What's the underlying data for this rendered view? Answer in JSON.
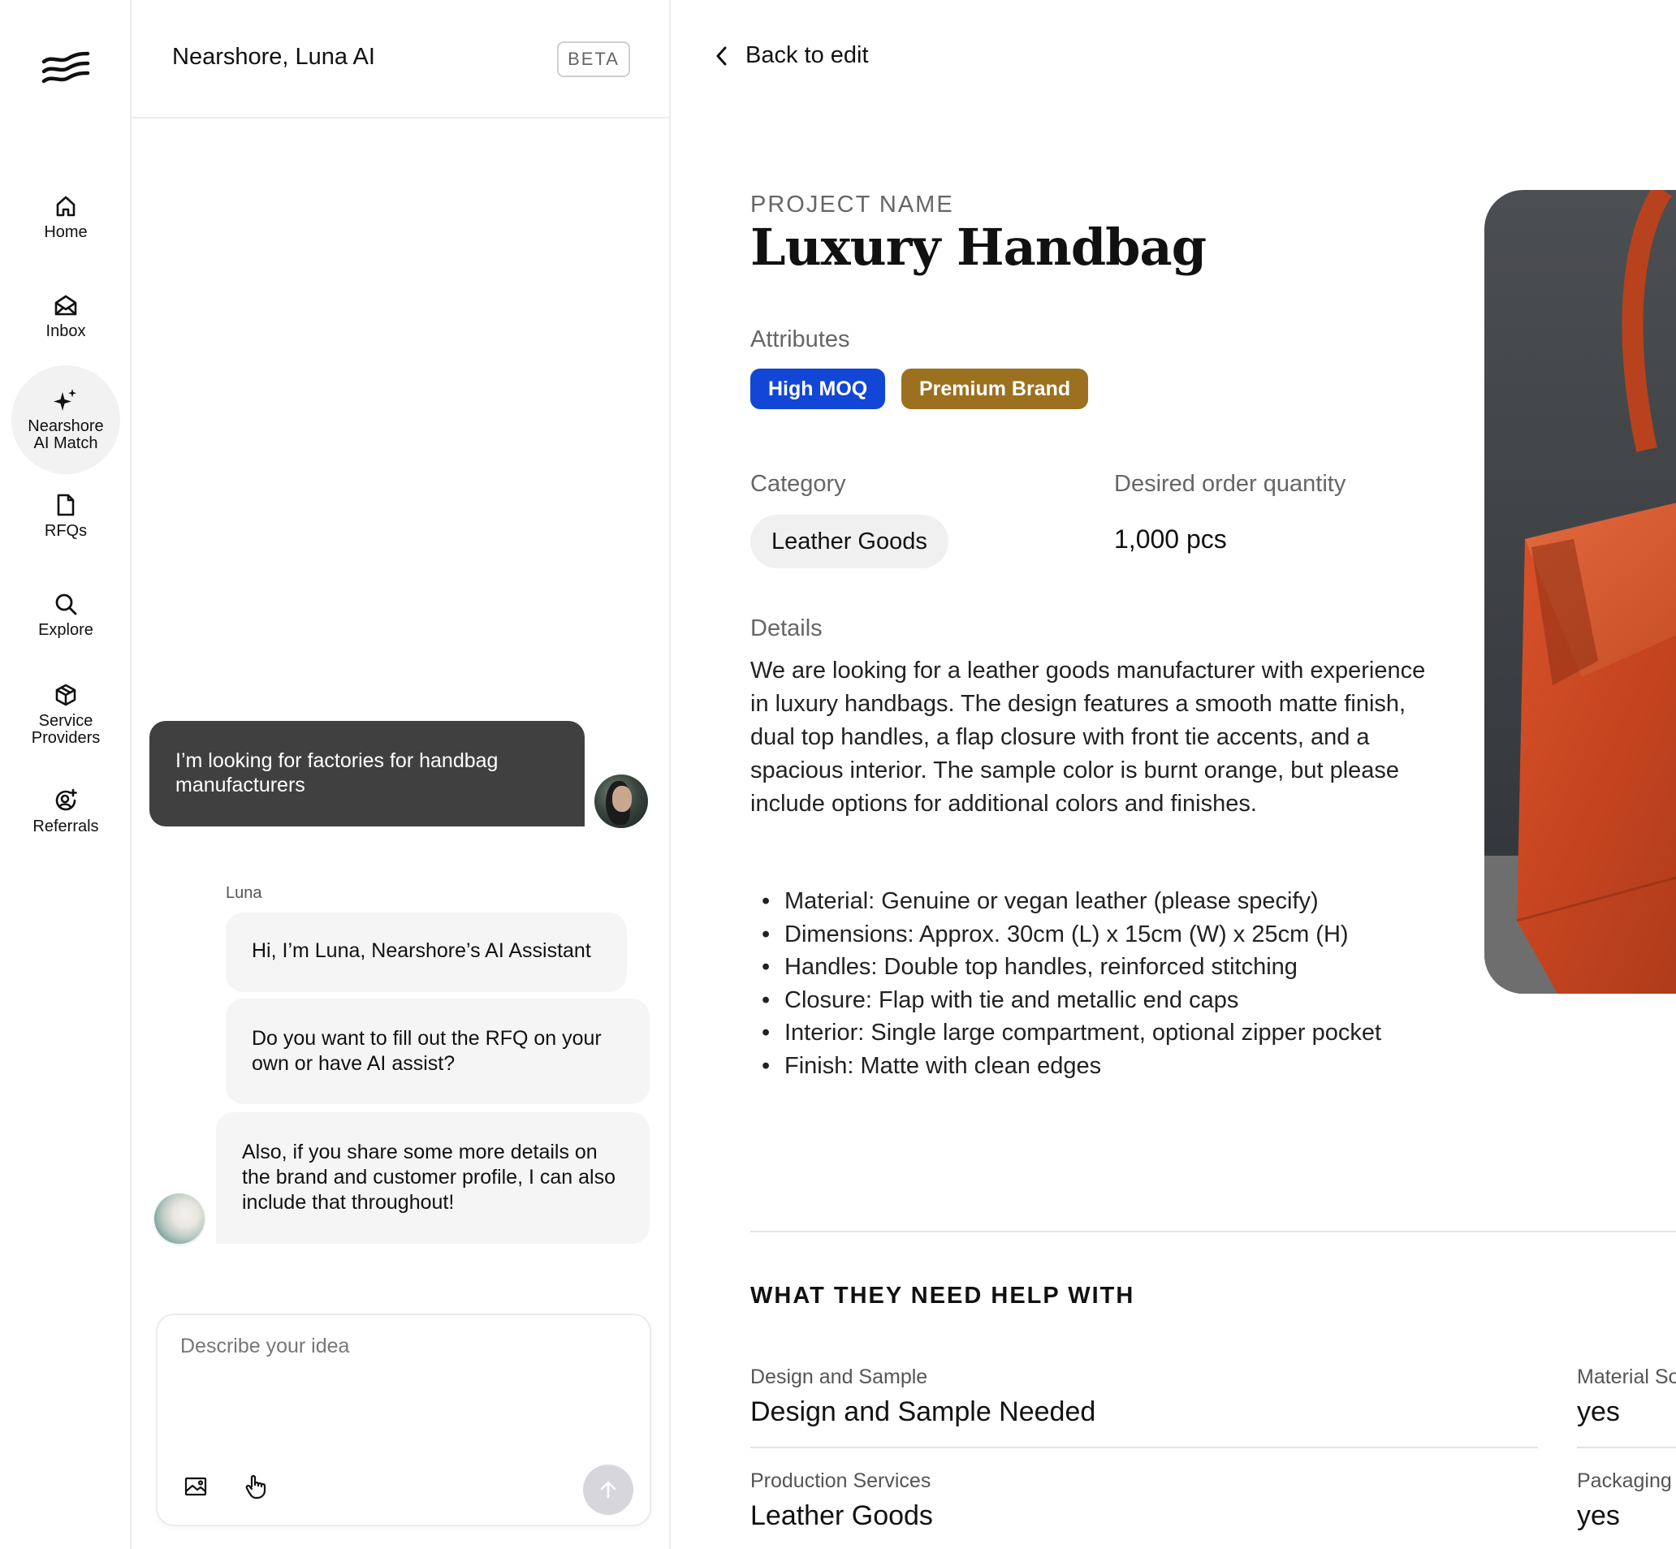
{
  "nav": {
    "items": [
      {
        "label": "Home",
        "icon": "home-icon"
      },
      {
        "label": "Inbox",
        "icon": "inbox-icon"
      },
      {
        "label": "Nearshore\nAI Match",
        "icon": "sparkle-icon",
        "active": true
      },
      {
        "label": "RFQs",
        "icon": "document-icon"
      },
      {
        "label": "Explore",
        "icon": "search-icon"
      },
      {
        "label": "Service\nProviders",
        "icon": "cube-icon"
      },
      {
        "label": "Referrals",
        "icon": "referral-icon"
      }
    ]
  },
  "chat": {
    "title": "Nearshore, Luna AI",
    "badge": "BETA",
    "user_message": "I’m looking for factories for handbag manufacturers",
    "assistant_name": "Luna",
    "assistant_messages": [
      "Hi, I’m Luna, Nearshore’s AI Assistant",
      "Do you want to fill out the RFQ on your own or have AI assist?",
      "Also, if you share some more details on the brand and customer profile, I can also include that throughout!"
    ],
    "composer": {
      "placeholder": "Describe your idea",
      "value": ""
    }
  },
  "main": {
    "back_label": "Back to edit",
    "project_label": "PROJECT NAME",
    "project_name": "Luxury Handbag",
    "attributes_label": "Attributes",
    "attributes": [
      {
        "label": "High MOQ",
        "color": "#1146d6"
      },
      {
        "label": "Premium Brand",
        "color": "#9b7120"
      }
    ],
    "category_label": "Category",
    "category": "Leather Goods",
    "quantity_label": "Desired order quantity",
    "quantity": "1,000 pcs",
    "details_label": "Details",
    "details_text": "We are looking for a leather goods manufacturer with experience in luxury handbags. The design features a smooth matte finish, dual top handles, a flap closure with front tie accents, and a spacious interior. The sample color is burnt orange, but please include options for additional colors and finishes.",
    "details_list": [
      "Material: Genuine or vegan leather (please specify)",
      "Dimensions: Approx. 30cm (L) x 15cm (W) x 25cm (H)",
      "Handles: Double top handles, reinforced stitching",
      "Closure: Flap with tie and metallic end caps",
      "Interior: Single large compartment, optional zipper pocket",
      "Finish: Matte with clean edges"
    ],
    "help_title": "WHAT THEY NEED HELP WITH",
    "help_items": [
      {
        "label": "Design and Sample",
        "value": "Design and Sample Needed"
      },
      {
        "label": "Material So",
        "value": "yes"
      },
      {
        "label": "Production Services",
        "value": "Leather Goods"
      },
      {
        "label": "Packaging",
        "value": "yes"
      }
    ]
  }
}
